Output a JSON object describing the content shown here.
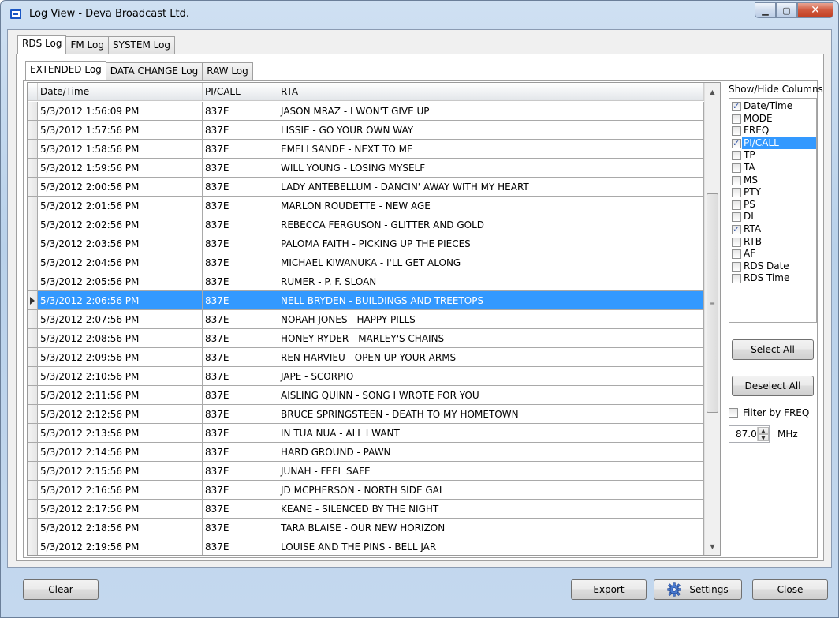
{
  "window": {
    "title": "Log View - Deva Broadcast Ltd."
  },
  "outer_tabs": [
    "RDS Log",
    "FM Log",
    "SYSTEM Log"
  ],
  "inner_tabs": [
    "EXTENDED Log",
    "DATA CHANGE Log",
    "RAW Log"
  ],
  "grid": {
    "columns": [
      "Date/Time",
      "PI/CALL",
      "RTA"
    ],
    "selected_index": 10,
    "rows": [
      [
        "5/3/2012 1:56:09 PM",
        "837E",
        "JASON MRAZ - I WON'T GIVE UP"
      ],
      [
        "5/3/2012 1:57:56 PM",
        "837E",
        "LISSIE - GO YOUR OWN WAY"
      ],
      [
        "5/3/2012 1:58:56 PM",
        "837E",
        "EMELI SANDE - NEXT TO ME"
      ],
      [
        "5/3/2012 1:59:56 PM",
        "837E",
        "WILL YOUNG - LOSING MYSELF"
      ],
      [
        "5/3/2012 2:00:56 PM",
        "837E",
        "LADY ANTEBELLUM - DANCIN' AWAY WITH MY HEART"
      ],
      [
        "5/3/2012 2:01:56 PM",
        "837E",
        "MARLON ROUDETTE - NEW AGE"
      ],
      [
        "5/3/2012 2:02:56 PM",
        "837E",
        "REBECCA FERGUSON - GLITTER AND GOLD"
      ],
      [
        "5/3/2012 2:03:56 PM",
        "837E",
        "PALOMA FAITH - PICKING UP THE PIECES"
      ],
      [
        "5/3/2012 2:04:56 PM",
        "837E",
        "MICHAEL KIWANUKA - I'LL GET ALONG"
      ],
      [
        "5/3/2012 2:05:56 PM",
        "837E",
        "RUMER - P. F. SLOAN"
      ],
      [
        "5/3/2012 2:06:56 PM",
        "837E",
        "NELL BRYDEN - BUILDINGS AND TREETOPS"
      ],
      [
        "5/3/2012 2:07:56 PM",
        "837E",
        "NORAH JONES - HAPPY PILLS"
      ],
      [
        "5/3/2012 2:08:56 PM",
        "837E",
        "HONEY RYDER - MARLEY'S CHAINS"
      ],
      [
        "5/3/2012 2:09:56 PM",
        "837E",
        "REN HARVIEU - OPEN UP YOUR ARMS"
      ],
      [
        "5/3/2012 2:10:56 PM",
        "837E",
        "JAPE - SCORPIO"
      ],
      [
        "5/3/2012 2:11:56 PM",
        "837E",
        "AISLING QUINN - SONG I WROTE FOR YOU"
      ],
      [
        "5/3/2012 2:12:56 PM",
        "837E",
        "BRUCE SPRINGSTEEN - DEATH TO MY HOMETOWN"
      ],
      [
        "5/3/2012 2:13:56 PM",
        "837E",
        "IN TUA NUA - ALL I WANT"
      ],
      [
        "5/3/2012 2:14:56 PM",
        "837E",
        "HARD GROUND - PAWN"
      ],
      [
        "5/3/2012 2:15:56 PM",
        "837E",
        "JUNAH - FEEL SAFE"
      ],
      [
        "5/3/2012 2:16:56 PM",
        "837E",
        "JD MCPHERSON - NORTH SIDE GAL"
      ],
      [
        "5/3/2012 2:17:56 PM",
        "837E",
        "KEANE - SILENCED BY THE NIGHT"
      ],
      [
        "5/3/2012 2:18:56 PM",
        "837E",
        "TARA BLAISE - OUR NEW HORIZON"
      ],
      [
        "5/3/2012 2:19:56 PM",
        "837E",
        "LOUISE AND THE PINS - BELL JAR"
      ]
    ]
  },
  "columns_panel": {
    "title": "Show/Hide Columns",
    "items": [
      {
        "label": "Date/Time",
        "checked": true
      },
      {
        "label": "MODE",
        "checked": false
      },
      {
        "label": "FREQ",
        "checked": false
      },
      {
        "label": "PI/CALL",
        "checked": true,
        "highlighted": true
      },
      {
        "label": "TP",
        "checked": false
      },
      {
        "label": "TA",
        "checked": false
      },
      {
        "label": "MS",
        "checked": false
      },
      {
        "label": "PTY",
        "checked": false
      },
      {
        "label": "PS",
        "checked": false
      },
      {
        "label": "DI",
        "checked": false
      },
      {
        "label": "RTA",
        "checked": true
      },
      {
        "label": "RTB",
        "checked": false
      },
      {
        "label": "AF",
        "checked": false
      },
      {
        "label": "RDS Date",
        "checked": false
      },
      {
        "label": "RDS Time",
        "checked": false
      }
    ],
    "select_all": "Select All",
    "deselect_all": "Deselect All",
    "filter_label": "Filter by FREQ",
    "filter_checked": false,
    "freq_value": "87.0",
    "freq_unit": "MHz"
  },
  "buttons": {
    "clear": "Clear",
    "export": "Export",
    "settings": "Settings",
    "close": "Close"
  },
  "colors": {
    "selection": "#3399ff",
    "title_bar": "#c4d8ee",
    "close_button": "#c13f22"
  },
  "icons": {
    "app": "app-window-icon",
    "settings": "gear-icon"
  }
}
